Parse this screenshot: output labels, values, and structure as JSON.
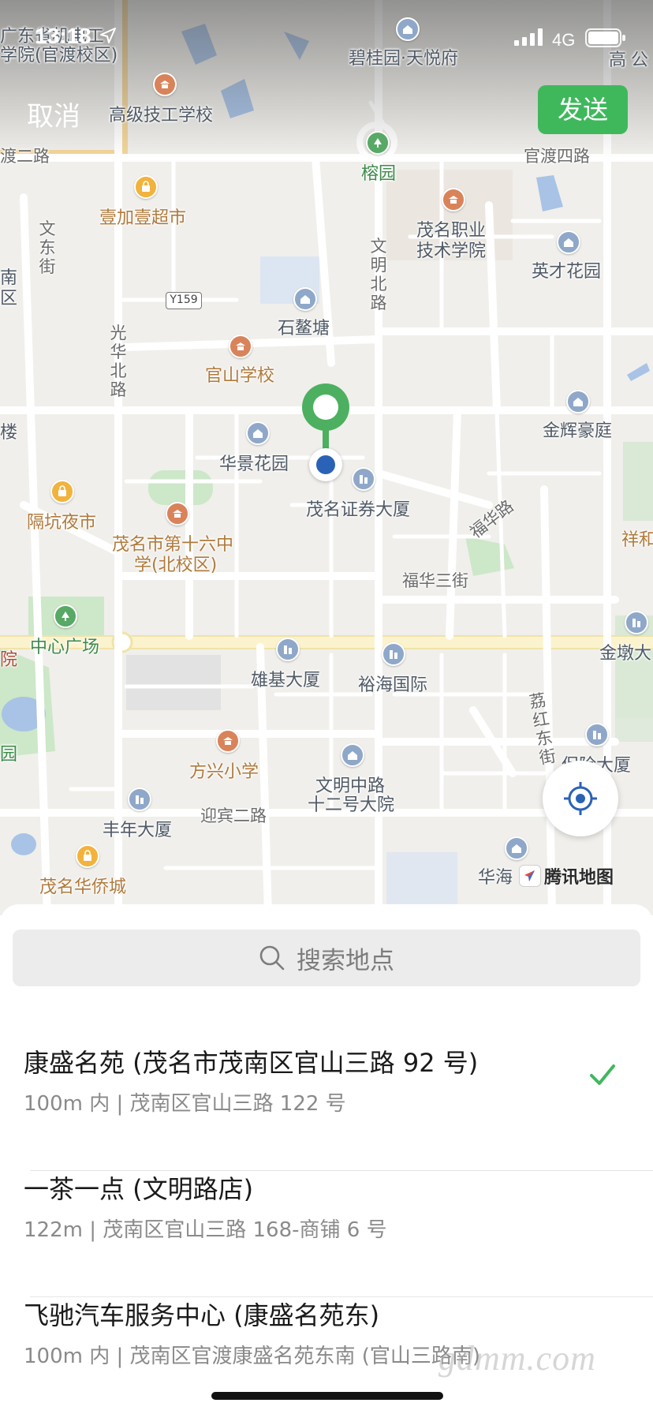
{
  "status_bar": {
    "time": "13:18",
    "network": "4G"
  },
  "nav": {
    "cancel_label": "取消",
    "send_label": "发送"
  },
  "map": {
    "labels": [
      "广东省机电工",
      "学院(官渡校区)",
      "碧桂园·天悦府",
      "高级技工学校",
      "渡二路",
      "榕园",
      "官渡四路",
      "壹加壹超市",
      "茂名职业",
      "技术学院",
      "文东街",
      "文明北路",
      "英才花园",
      "石鳌塘",
      "光华北路",
      "官山学校",
      "金辉豪庭",
      "华景花园",
      "茂名证券大厦",
      "福华路",
      "隔坑夜市",
      "茂名市第十六中",
      "学(北校区)",
      "福华三街",
      "祥和",
      "中心广场",
      "雄基大厦",
      "裕海国际",
      "金墩大",
      "荔红东街",
      "方兴小学",
      "保险大厦",
      "文明中路",
      "十二号大院",
      "迎宾二路",
      "丰年大厦",
      "茂名华侨城",
      "华海",
      "楼",
      "南",
      "区",
      "院",
      "园",
      "高",
      "公"
    ],
    "road_shield": "Y159",
    "brand": "腾讯地图"
  },
  "search": {
    "placeholder": "搜索地点"
  },
  "results": [
    {
      "name": "康盛名苑 (茂名市茂南区官山三路 92 号)",
      "address": "100m 内 | 茂南区官山三路 122 号",
      "selected": true
    },
    {
      "name": "一茶一点 (文明路店)",
      "address": "122m | 茂南区官山三路 168-商铺 6 号",
      "selected": false
    },
    {
      "name": "飞驰汽车服务中心 (康盛名苑东)",
      "address": "100m 内 | 茂南区官渡康盛名苑东南 (官山三路南)",
      "selected": false
    }
  ],
  "watermark": "gdmm.com",
  "colors": {
    "accent_green": "#3fb85c",
    "pin_green": "#4cb060",
    "location_blue": "#2a62b6",
    "check_green": "#3fb85c"
  }
}
